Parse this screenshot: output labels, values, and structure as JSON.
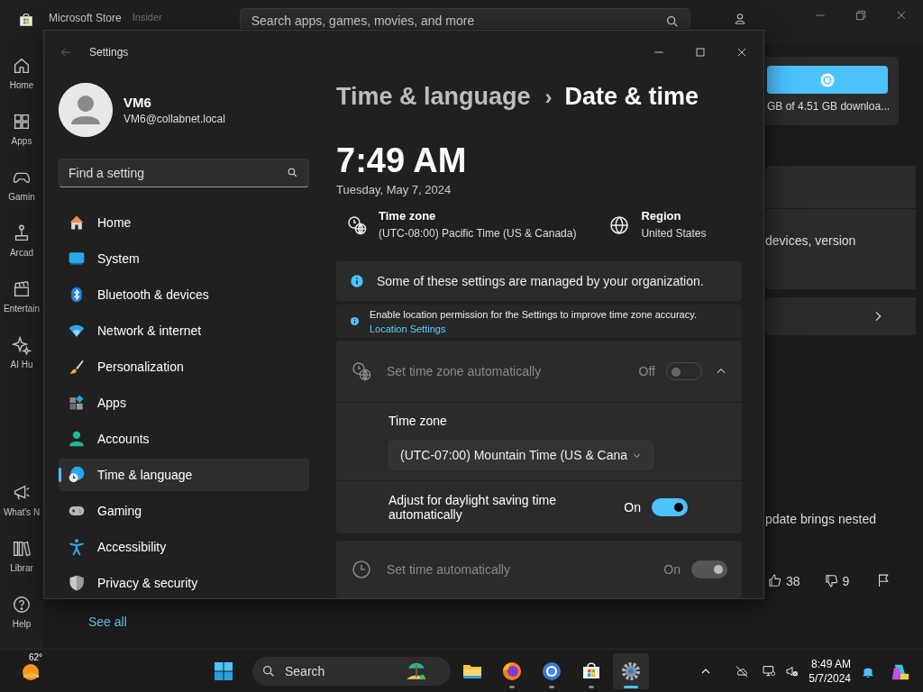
{
  "store": {
    "title": "Microsoft Store",
    "badge": "Insider",
    "search": {
      "placeholder": "Search apps, games, movies, and more"
    },
    "nav_top": [
      {
        "label": "Home"
      },
      {
        "label": "Apps"
      },
      {
        "label": "Gamin"
      },
      {
        "label": "Arcad"
      },
      {
        "label": "Entertain"
      },
      {
        "label": "AI Hu"
      }
    ],
    "nav_bottom": [
      {
        "label": "What's N"
      },
      {
        "label": "Librar"
      },
      {
        "label": "Help"
      }
    ],
    "download": {
      "caption": "GB of 4.51 GB downloa..."
    },
    "card_text": "devices, version",
    "news_text": "pdate brings nested",
    "likes": "38",
    "dislikes": "9",
    "see_all": "See all"
  },
  "settings": {
    "title": "Settings",
    "user": {
      "name": "VM6",
      "email": "VM6@collabnet.local"
    },
    "search": {
      "placeholder": "Find a setting"
    },
    "nav": [
      {
        "label": "Home",
        "selected": false
      },
      {
        "label": "System",
        "selected": false
      },
      {
        "label": "Bluetooth & devices",
        "selected": false
      },
      {
        "label": "Network & internet",
        "selected": false
      },
      {
        "label": "Personalization",
        "selected": false
      },
      {
        "label": "Apps",
        "selected": false
      },
      {
        "label": "Accounts",
        "selected": false
      },
      {
        "label": "Time & language",
        "selected": true
      },
      {
        "label": "Gaming",
        "selected": false
      },
      {
        "label": "Accessibility",
        "selected": false
      },
      {
        "label": "Privacy & security",
        "selected": false
      }
    ],
    "breadcrumb": {
      "parent": "Time & language",
      "separator": "›",
      "current": "Date & time"
    },
    "clock": "7:49 AM",
    "date": "Tuesday, May 7, 2024",
    "time_zone": {
      "label": "Time zone",
      "value": "(UTC-08:00) Pacific Time (US & Canada)"
    },
    "region": {
      "label": "Region",
      "value": "United States"
    },
    "notice": "Some of these settings are managed by your organization.",
    "location": {
      "text": "Enable location permission for the Settings to improve time zone accuracy.",
      "link": "Location Settings"
    },
    "rows": [
      {
        "kind": "expander",
        "label": "Set time zone automatically",
        "state": "Off",
        "on": false,
        "disabled": true,
        "expanded": true,
        "children": [
          {
            "kind": "dropdown",
            "label": "Time zone",
            "value": "(UTC-07:00) Mountain Time (US & Cana"
          },
          {
            "kind": "toggle",
            "label": "Adjust for daylight saving time automatically",
            "state": "On",
            "on": true,
            "disabled": false
          }
        ]
      },
      {
        "kind": "toggle_card",
        "label": "Set time automatically",
        "state": "On",
        "on": true,
        "disabled": true
      }
    ]
  },
  "taskbar": {
    "weather": "62°",
    "search": "Search",
    "apps": [
      {
        "running": false,
        "active": false
      },
      {
        "running": true,
        "active": false
      },
      {
        "running": true,
        "active": false
      },
      {
        "running": true,
        "active": false
      },
      {
        "running": true,
        "active": true
      }
    ],
    "time": "8:49 AM",
    "date": "5/7/2024"
  }
}
